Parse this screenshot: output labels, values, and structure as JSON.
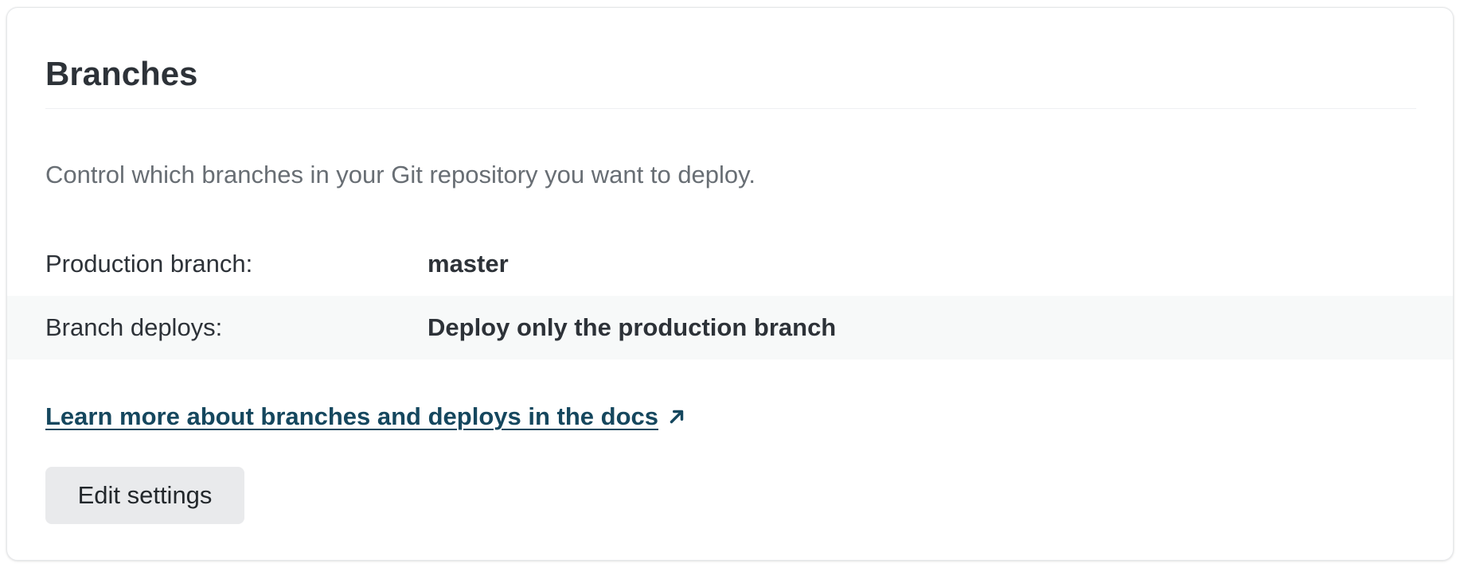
{
  "card": {
    "title": "Branches",
    "description": "Control which branches in your Git repository you want to deploy."
  },
  "settings": [
    {
      "label": "Production branch:",
      "value": "master"
    },
    {
      "label": "Branch deploys:",
      "value": "Deploy only the production branch"
    }
  ],
  "docs_link": {
    "text": "Learn more about branches and deploys in the docs",
    "icon": "external-link-arrow-icon"
  },
  "actions": {
    "edit_label": "Edit settings"
  },
  "colors": {
    "link": "#15475e",
    "text": "#2d3238",
    "muted": "#686e74",
    "button_bg": "#e9eaec",
    "row_highlight": "#f7f9f9"
  }
}
